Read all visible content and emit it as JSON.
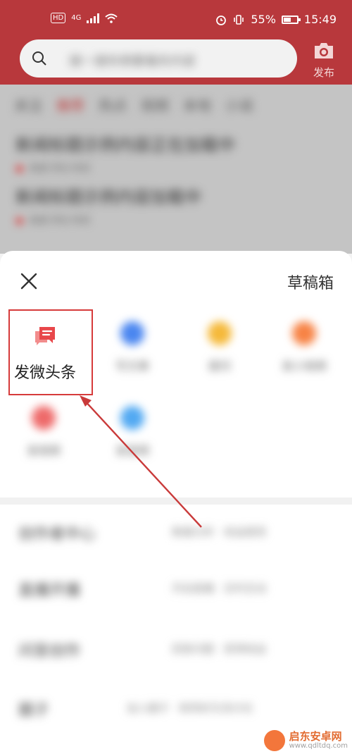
{
  "status_bar": {
    "hd": "HD",
    "network": "4G",
    "battery_percent": "55%",
    "time": "15:49"
  },
  "header": {
    "search_placeholder": "搜一搜你想要看的内容",
    "publish_label": "发布"
  },
  "feed": {
    "tabs": [
      "关注",
      "推荐",
      "热点",
      "视频",
      "本地",
      "小说"
    ],
    "items": [
      {
        "title": "新闻标题示例内容正在加载中",
        "meta": "来源 评论 时间"
      },
      {
        "title": "新闻标题示例内容加载中",
        "meta": "来源 评论 时间"
      }
    ]
  },
  "sheet": {
    "drafts_label": "草稿箱",
    "grid": [
      {
        "label": "发微头条",
        "color": "#e8474a"
      },
      {
        "label": "写文章",
        "color": "#4a86f0"
      },
      {
        "label": "提问",
        "color": "#f5b93a"
      },
      {
        "label": "发小视频",
        "color": "#f78345"
      },
      {
        "label": "发视频",
        "color": "#ee6a6a"
      },
      {
        "label": "发音频",
        "color": "#52a9f2"
      }
    ],
    "rows": [
      {
        "title": "创作者中心",
        "desc": "数据分析 · 收益提现"
      },
      {
        "title": "直播开播",
        "desc": "开启直播 · 实时互动"
      },
      {
        "title": "问答创作",
        "desc": "回答问题 · 获得收益"
      },
      {
        "title": "圈子",
        "desc": "加入圈子 · 和同好交流讨论"
      }
    ]
  },
  "watermark": {
    "title": "启东安卓网",
    "url": "www.qdltdq.com"
  },
  "colors": {
    "brand_red": "#b8383c",
    "highlight": "#d63b3b"
  }
}
